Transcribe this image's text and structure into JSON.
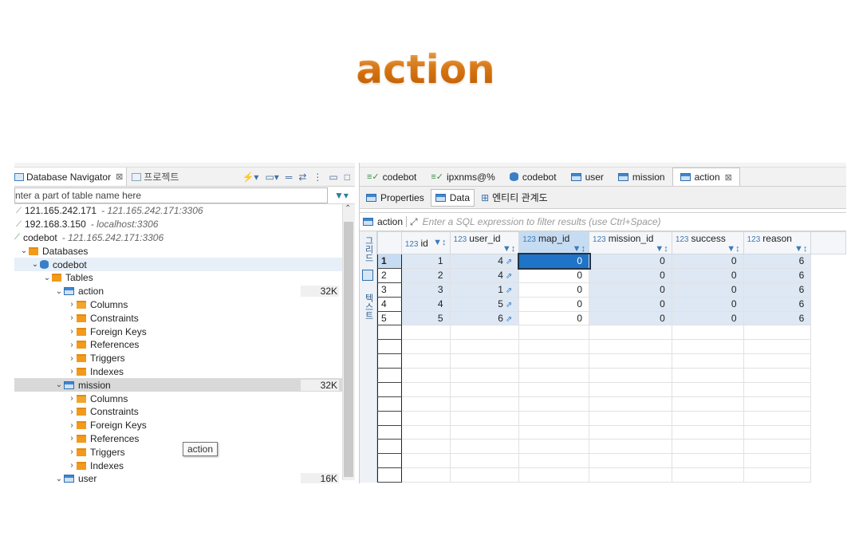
{
  "slide": {
    "title": "action"
  },
  "navigator": {
    "tab_label": "Database Navigator",
    "tab2_label": "프로젝트",
    "search_placeholder": "nter a part of table name here",
    "tree": [
      {
        "name": "121.165.242.171",
        "sub": "- 121.165.242.171:3306"
      },
      {
        "name": "192.168.3.150",
        "sub": "- localhost:3306"
      },
      {
        "name": "codebot",
        "sub": "- 121.165.242.171:3306"
      },
      {
        "name": "Databases"
      },
      {
        "name": "codebot"
      },
      {
        "name": "Tables"
      },
      {
        "name": "action",
        "size": "32K"
      },
      {
        "name": "Columns"
      },
      {
        "name": "Constraints"
      },
      {
        "name": "Foreign Keys"
      },
      {
        "name": "References"
      },
      {
        "name": "Triggers"
      },
      {
        "name": "Indexes"
      },
      {
        "name": "mission",
        "size": "32K"
      },
      {
        "name": "Columns"
      },
      {
        "name": "Constraints"
      },
      {
        "name": "Foreign Keys"
      },
      {
        "name": "References"
      },
      {
        "name": "Triggers"
      },
      {
        "name": "Indexes"
      },
      {
        "name": "user",
        "size": "16K"
      }
    ],
    "tooltip": "action"
  },
  "editor": {
    "tabs": [
      "codebot",
      "ipxnms@%",
      "codebot",
      "user",
      "mission",
      "action"
    ],
    "subtabs": [
      "Properties",
      "Data",
      "엔티티 관계도"
    ],
    "filter_table": "action",
    "filter_placeholder": "Enter a SQL expression to filter results (use Ctrl+Space)",
    "sidebar_labels": [
      "그리드",
      "텍스트"
    ],
    "columns": [
      "id",
      "user_id",
      "map_id",
      "mission_id",
      "success",
      "reason"
    ],
    "rows": [
      [
        "1",
        "1",
        "4",
        "0",
        "0",
        "0",
        "6"
      ],
      [
        "2",
        "2",
        "4",
        "0",
        "0",
        "0",
        "6"
      ],
      [
        "3",
        "3",
        "1",
        "0",
        "0",
        "0",
        "6"
      ],
      [
        "4",
        "4",
        "5",
        "0",
        "0",
        "0",
        "6"
      ],
      [
        "5",
        "5",
        "6",
        "0",
        "0",
        "0",
        "6"
      ]
    ],
    "type_badge": "123"
  }
}
